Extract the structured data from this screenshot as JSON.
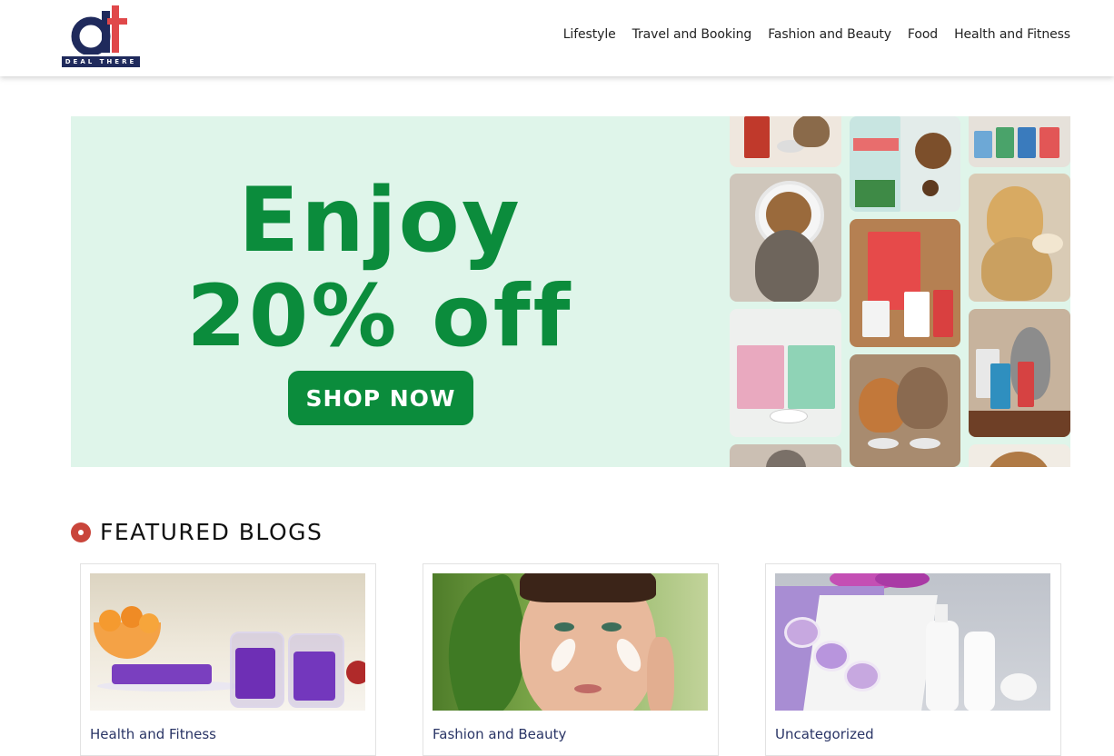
{
  "brand": {
    "logo_text": "DEAL THERE",
    "colors": {
      "navy": "#1f2a5c",
      "red": "#e0484a"
    }
  },
  "nav": {
    "items": [
      {
        "label": "Lifestyle"
      },
      {
        "label": "Travel and Booking"
      },
      {
        "label": "Fashion and Beauty"
      },
      {
        "label": "Food"
      },
      {
        "label": "Health and Fitness"
      }
    ]
  },
  "banner": {
    "line1": "Enjoy",
    "line2": "20% off",
    "button": "SHOP NOW",
    "colors": {
      "background": "#dff5ea",
      "green": "#0b8c3c"
    }
  },
  "featured": {
    "title": "FEATURED BLOGS",
    "icon": "bullet-circle-icon",
    "accent": "#c9453b",
    "cards": [
      {
        "category": "Health and Fitness"
      },
      {
        "category": "Fashion and Beauty"
      },
      {
        "category": "Uncategorized"
      }
    ]
  }
}
